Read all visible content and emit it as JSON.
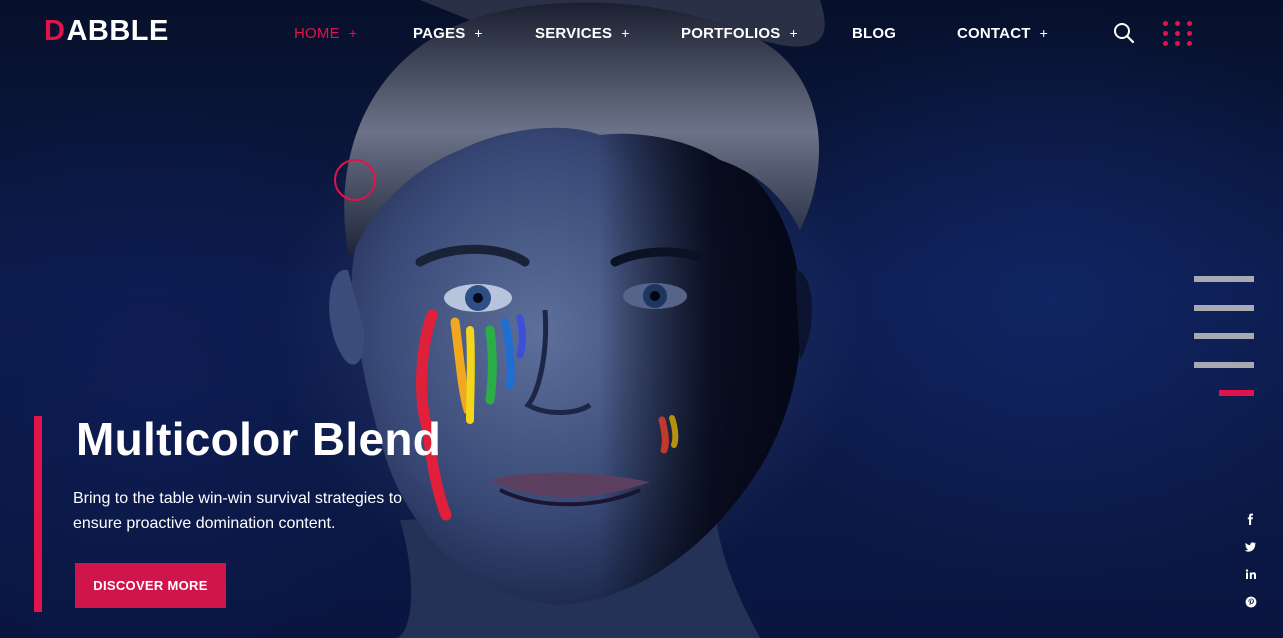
{
  "brand": {
    "logo_mark": "D",
    "logo_rest": "ABBLE",
    "accent_color": "#e0144a"
  },
  "nav": {
    "items": [
      {
        "label": "HOME",
        "plus": "+"
      },
      {
        "label": "PAGES",
        "plus": "+"
      },
      {
        "label": "SERVICES",
        "plus": "+"
      },
      {
        "label": "PORTFOLIOS",
        "plus": "+"
      },
      {
        "label": "BLOG",
        "plus": ""
      },
      {
        "label": "CONTACT",
        "plus": "+"
      }
    ],
    "active_index": 0
  },
  "header_icons": {
    "search": "search-icon",
    "menu": "dots-grid-icon"
  },
  "slider": {
    "slide_count": 5,
    "active_slide": 5
  },
  "hero": {
    "title": "Multicolor Blend",
    "text": "Bring to the table win-win survival strategies to ensure proactive domination content.",
    "cta_label": "DISCOVER MORE"
  },
  "social": [
    {
      "name": "facebook-icon",
      "glyph": "f"
    },
    {
      "name": "twitter-icon",
      "glyph": "t"
    },
    {
      "name": "linkedin-icon",
      "glyph": "in"
    },
    {
      "name": "pinterest-icon",
      "glyph": "p"
    }
  ]
}
